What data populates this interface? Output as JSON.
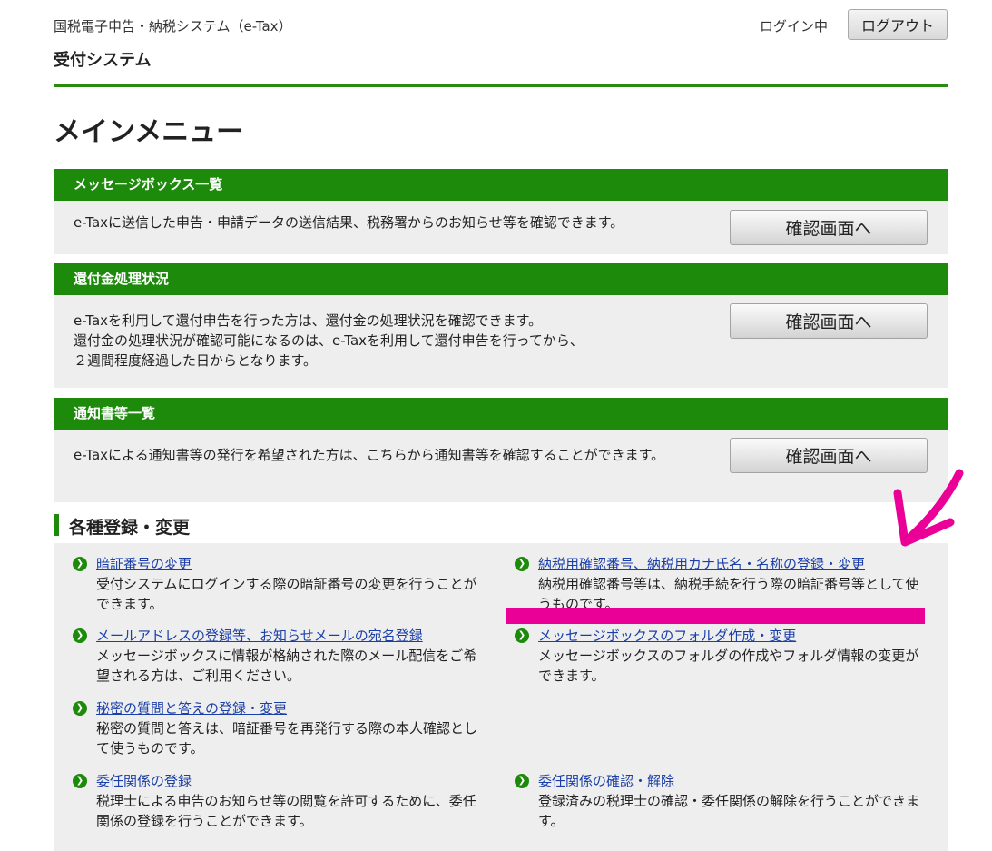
{
  "header": {
    "system_name": "国税電子申告・納税システム（e-Tax）",
    "subsystem": "受付システム",
    "login_status": "ログイン中",
    "logout_label": "ログアウト"
  },
  "page_title": "メインメニュー",
  "panels": [
    {
      "title": "メッセージボックス一覧",
      "text": "e-Taxに送信した申告・申請データの送信結果、税務署からのお知らせ等を確認できます。",
      "button": "確認画面へ"
    },
    {
      "title": "還付金処理状況",
      "text": "e-Taxを利用して還付申告を行った方は、還付金の処理状況を確認できます。\n還付金の処理状況が確認可能になるのは、e-Taxを利用して還付申告を行ってから、\n２週間程度経過した日からとなります。",
      "button": "確認画面へ"
    },
    {
      "title": "通知書等一覧",
      "text": "e-Taxによる通知書等の発行を希望された方は、こちらから通知書等を確認することができます。",
      "button": "確認画面へ"
    }
  ],
  "section": {
    "title": "各種登録・変更",
    "links": [
      {
        "title": "暗証番号の変更",
        "desc": "受付システムにログインする際の暗証番号の変更を行うことができます。"
      },
      {
        "title": "納税用確認番号、納税用カナ氏名・名称の登録・変更",
        "desc": "納税用確認番号等は、納税手続を行う際の暗証番号等として使うものです。"
      },
      {
        "title": "メールアドレスの登録等、お知らせメールの宛名登録",
        "desc": "メッセージボックスに情報が格納された際のメール配信をご希望される方は、ご利用ください。"
      },
      {
        "title": "メッセージボックスのフォルダ作成・変更",
        "desc": "メッセージボックスのフォルダの作成やフォルダ情報の変更ができます。"
      },
      {
        "title": "秘密の質問と答えの登録・変更",
        "desc": "秘密の質問と答えは、暗証番号を再発行する際の本人確認として使うものです。"
      },
      {
        "title": "委任関係の登録",
        "desc": "税理士による申告のお知らせ等の閲覧を許可するために、委任関係の登録を行うことができます。"
      },
      {
        "title": "委任関係の確認・解除",
        "desc": "登録済みの税理士の確認・委任関係の解除を行うことができます。"
      }
    ]
  },
  "colors": {
    "brand_green": "#1d8a0c",
    "link_blue": "#1a3fa8",
    "annotation_pink": "#ea0096"
  },
  "icons": {
    "link_bullet": "chevron-right-circle-icon"
  }
}
